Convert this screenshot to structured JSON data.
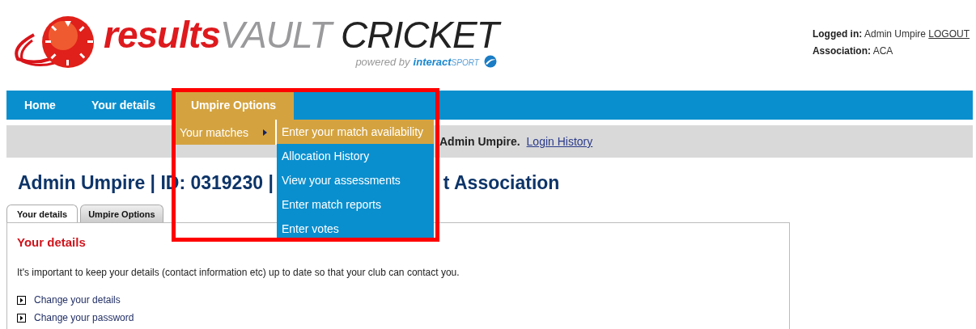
{
  "logo": {
    "word_1": "results",
    "word_2": "VAULT",
    "word_3": "CRICKET",
    "tagline": "powered by",
    "brand_1": "interact",
    "brand_2": "SPORT"
  },
  "account": {
    "logged_in_label": "Logged in:",
    "user": "Admin Umpire",
    "logout": "LOGOUT",
    "association_label": "Association:",
    "association": "ACA"
  },
  "nav": [
    {
      "label": "Home",
      "selected": false
    },
    {
      "label": "Your details",
      "selected": false
    },
    {
      "label": "Umpire Options",
      "selected": true
    }
  ],
  "dropdown": {
    "item": {
      "label": "Your matches",
      "selected": true
    },
    "submenu": [
      {
        "label": "Enter your match availability",
        "selected": true
      },
      {
        "label": "Allocation History",
        "selected": false
      },
      {
        "label": "View your assessments",
        "selected": false
      },
      {
        "label": "Enter match reports",
        "selected": false
      },
      {
        "label": "Enter votes",
        "selected": false
      }
    ]
  },
  "welcome": {
    "text": "Admin Umpire.",
    "link": "Login History"
  },
  "heading": {
    "part_1": "Admin Umpire | ID: 0319230 |",
    "part_2": "t Association"
  },
  "tabs": [
    {
      "label": "Your details",
      "selected": true
    },
    {
      "label": "Umpire Options",
      "selected": false
    }
  ],
  "panel": {
    "title": "Your details",
    "intro": "It's important to keep your details (contact information etc) up to date so that your club can contact you.",
    "links": [
      "Change your details",
      "Change your password"
    ]
  },
  "annotation": {
    "kind": "frame",
    "color": "#ff0000"
  }
}
